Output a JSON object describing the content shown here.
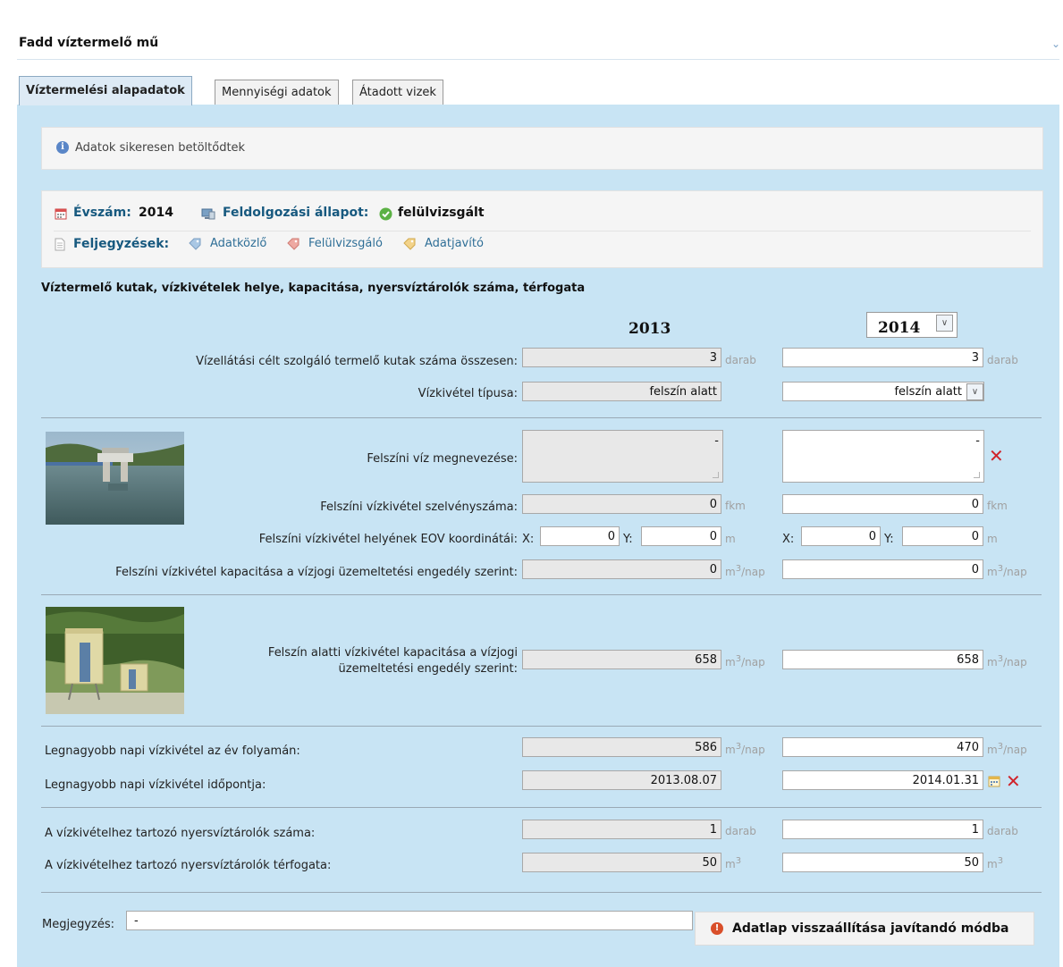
{
  "panel": {
    "title": "Fadd víztermelő mű"
  },
  "tabs": [
    {
      "label": "Víztermelési alapadatok"
    },
    {
      "label": "Mennyiségi adatok"
    },
    {
      "label": "Átadott vizek"
    }
  ],
  "message": "Adatok sikeresen betöltődtek",
  "status": {
    "year_label": "Évszám:",
    "year_value": "2014",
    "state_label": "Feldolgozási állapot:",
    "state_value": "felülvizsgált",
    "notes_label": "Feljegyzések:",
    "notes_links": [
      "Adatközlő",
      "Felülvizsgáló",
      "Adatjavító"
    ]
  },
  "section_heading": "Víztermelő kutak, vízkivételek helye, kapacitása, nyersvíztárolók száma, térfogata",
  "years": {
    "prev": "2013",
    "curr": "2014"
  },
  "rows": {
    "kutak": {
      "label": "Vízellátási célt szolgáló termelő kutak száma összesen:",
      "prev": "3",
      "curr": "3",
      "unit": "darab"
    },
    "tipus": {
      "label": "Vízkivétel típusa:",
      "prev": "felszín alatt",
      "curr": "felszín alatt"
    },
    "felszini_nev": {
      "label": "Felszíni víz megnevezése:",
      "prev": "-",
      "curr": "-"
    },
    "szelveny": {
      "label": "Felszíni vízkivétel szelvényszáma:",
      "prev": "0",
      "curr": "0",
      "unit": "fkm"
    },
    "eov": {
      "label": "Felszíni vízkivétel helyének EOV koordinátái:",
      "x_label": "X:",
      "y_label": "Y:",
      "prev_x": "0",
      "prev_y": "0",
      "curr_x": "0",
      "curr_y": "0",
      "unit": "m"
    },
    "felszini_kap": {
      "label": "Felszíni vízkivétel kapacitása a vízjogi üzemeltetési engedély szerint:",
      "prev": "0",
      "curr": "0"
    },
    "felszin_alatti_kap": {
      "label_line1": "Felszín alatti vízkivétel kapacitása a vízjogi",
      "label_line2": "üzemeltetési engedély szerint:",
      "prev": "658",
      "curr": "658"
    },
    "legnagyobb": {
      "label": "Legnagyobb napi vízkivétel az év folyamán:",
      "prev": "586",
      "curr": "470"
    },
    "idopont": {
      "label": "Legnagyobb napi vízkivétel időpontja:",
      "prev": "2013.08.07",
      "curr": "2014.01.31"
    },
    "tarolok_szama": {
      "label": "A vízkivételhez tartozó nyersvíztárolók száma:",
      "prev": "1",
      "curr": "1",
      "unit": "darab"
    },
    "tarolok_terfogata": {
      "label": "A vízkivételhez tartozó nyersvíztárolók térfogata:",
      "prev": "50",
      "curr": "50",
      "unit_base": "m",
      "unit_sup": "3"
    }
  },
  "unit_flow": {
    "base": "m",
    "sup": "3",
    "suffix": "/nap"
  },
  "megjegyzes": {
    "label": "Megjegyzés:",
    "value": "-"
  },
  "restore_button": "Adatlap visszaállítása javítandó módba",
  "colors": {
    "content_bg": "#c8e4f4",
    "label_blue": "#17597f",
    "delete_red": "#d0232a"
  }
}
